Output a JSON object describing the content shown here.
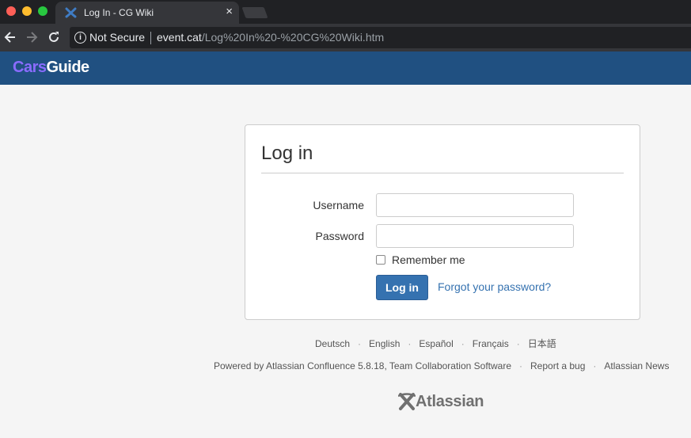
{
  "browser": {
    "tab_title": "Log In - CG Wiki",
    "tab_close": "×",
    "security_label": "Not Secure",
    "url_host": "event.cat",
    "url_path": "/Log%20In%20-%20CG%20Wiki.htm"
  },
  "header": {
    "logo_part1": "Cars",
    "logo_part2": "Guide",
    "logo_colors": {
      "cars": "#8a6cff",
      "guide": "#ffffff",
      "bar": "#205081"
    }
  },
  "login": {
    "title": "Log in",
    "username_label": "Username",
    "username_value": "",
    "password_label": "Password",
    "password_value": "",
    "remember_label": "Remember me",
    "remember_checked": false,
    "submit_label": "Log in",
    "forgot_link": "Forgot your password?",
    "accent": "#3572b0"
  },
  "footer": {
    "languages": [
      "Deutsch",
      "English",
      "Español",
      "Français",
      "日本語"
    ],
    "powered_by": "Powered by Atlassian Confluence 5.8.18, Team Collaboration Software",
    "report_bug": "Report a bug",
    "atlassian_news": "Atlassian News",
    "brand": "Atlassian"
  }
}
